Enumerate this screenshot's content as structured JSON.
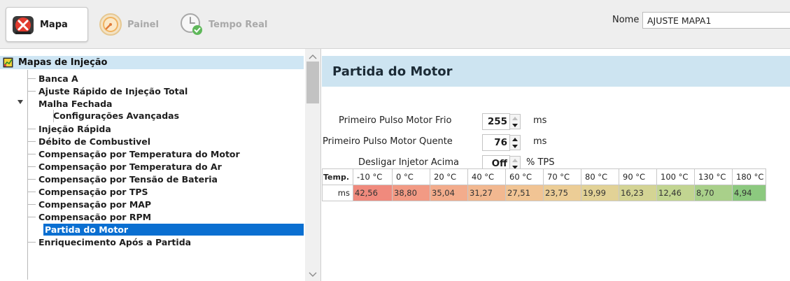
{
  "toolbar": {
    "tabs": [
      {
        "label": "Mapa",
        "icon": "wrench-car-icon",
        "active": true
      },
      {
        "label": "Painel",
        "icon": "gauge-icon",
        "active": false
      },
      {
        "label": "Tempo Real",
        "icon": "clock-check-icon",
        "active": false
      }
    ],
    "nome_label": "Nome",
    "nome_value": "AJUSTE MAPA1"
  },
  "tree": {
    "root_label": "Mapas de Injeção",
    "items": [
      "Banca A",
      "Ajuste Rápido de Injeção Total",
      "Malha Fechada",
      "Configurações Avançadas",
      "Injeção Rápida",
      "Débito de Combustivel",
      "Compensação por Temperatura do Motor",
      "Compensação por Temperatura do Ar",
      "Compensação por Tensão de Bateria",
      "Compensação por TPS",
      "Compensação por MAP",
      "Compensação por RPM",
      "Partida do Motor",
      "Enriquecimento Após a Partida"
    ],
    "selected": "Partida do Motor"
  },
  "content": {
    "title": "Partida do Motor",
    "params": [
      {
        "label": "Primeiro Pulso Motor Frio",
        "value": "255",
        "unit": "ms"
      },
      {
        "label": "Primeiro Pulso Motor Quente",
        "value": "76",
        "unit": "ms"
      },
      {
        "label": "Desligar Injetor Acima",
        "value": "Off",
        "unit": "% TPS"
      }
    ],
    "table": {
      "corner": "Temp.",
      "row_label": "ms",
      "headers": [
        "-10 °C",
        "0 °C",
        "20 °C",
        "40 °C",
        "60 °C",
        "70 °C",
        "80 °C",
        "90 °C",
        "100 °C",
        "130 °C",
        "180 °C"
      ],
      "values": [
        "42,56",
        "38,80",
        "35,04",
        "31,27",
        "27,51",
        "23,75",
        "19,99",
        "16,23",
        "12,46",
        "8,70",
        "4,94"
      ],
      "cell_colors": [
        "#f08a7d",
        "#f29a84",
        "#f3ac8c",
        "#f2b890",
        "#f1c494",
        "#eccd96",
        "#e2d296",
        "#d4d494",
        "#c2d591",
        "#a9d08a",
        "#8cc97f"
      ]
    }
  },
  "colors": {
    "accent": "#0a6fd1",
    "header_bg": "#cde4f1",
    "tree_root_bg": "#cfe6f4"
  }
}
